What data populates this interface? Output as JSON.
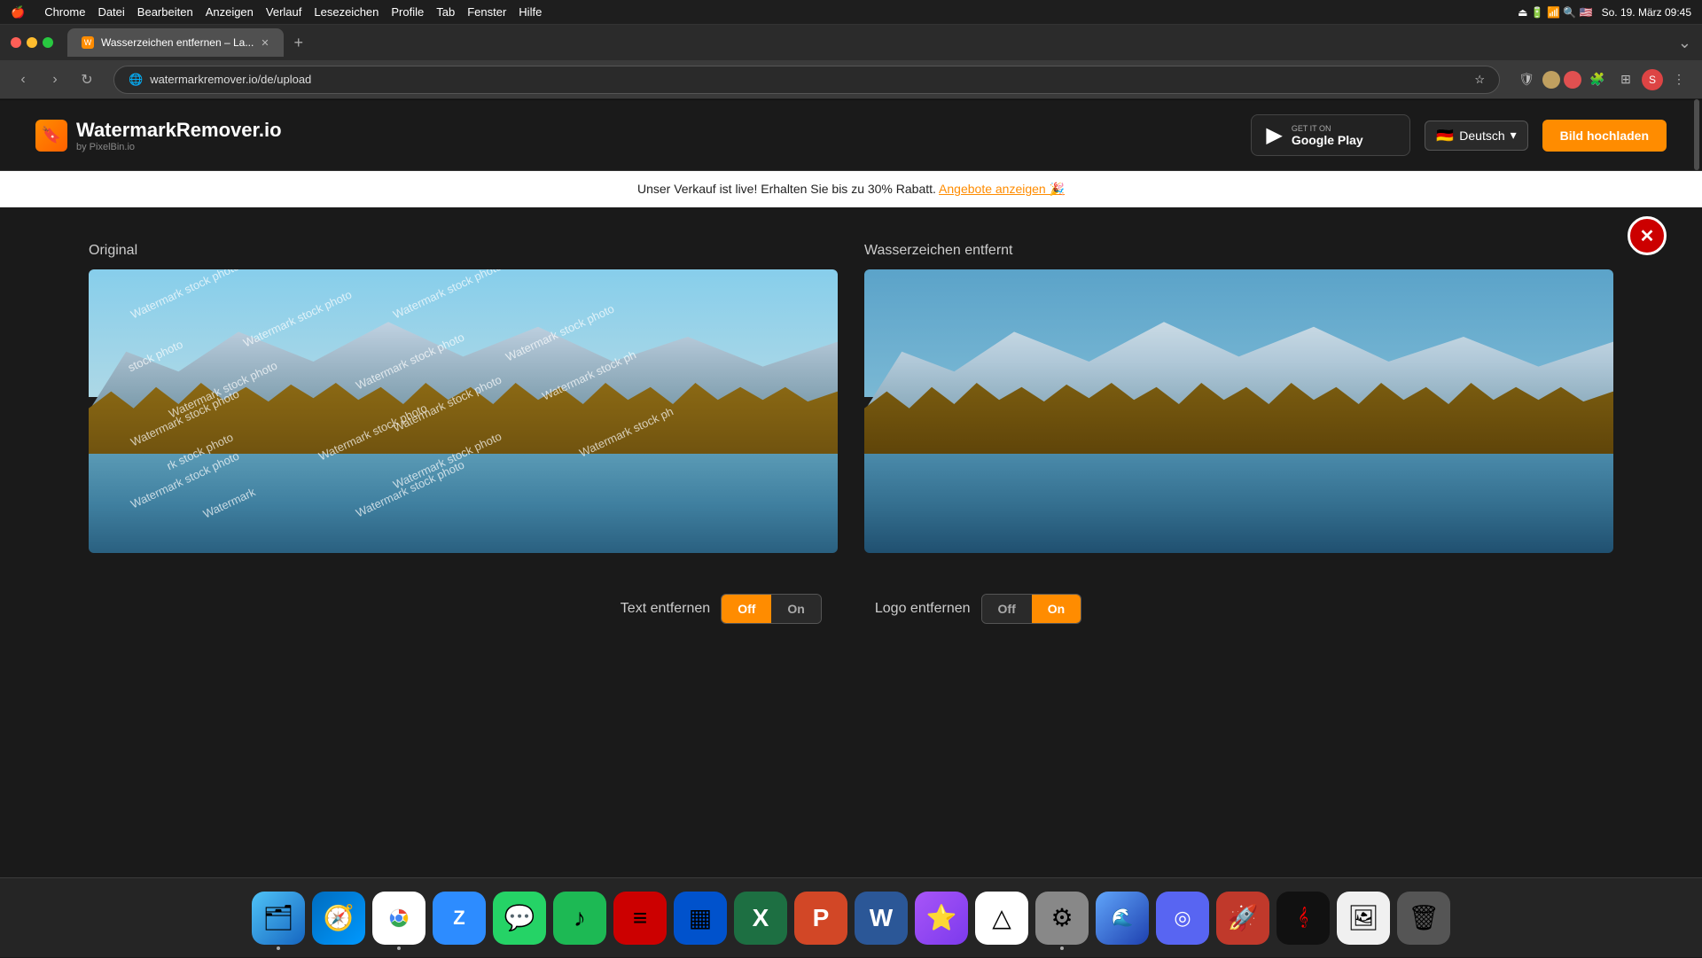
{
  "menubar": {
    "apple": "🍎",
    "items": [
      "Chrome",
      "Datei",
      "Bearbeiten",
      "Anzeigen",
      "Verlauf",
      "Lesezeichen",
      "Profile",
      "Tab",
      "Fenster",
      "Hilfe"
    ],
    "datetime": "So. 19. März  09:45"
  },
  "browser": {
    "tab_title": "Wasserzeichen entfernen – La...",
    "address": "watermarkremover.io/de/upload",
    "dropdown_label": "▾"
  },
  "header": {
    "logo_text": "WatermarkRemover.io",
    "logo_sub": "by PixelBin.io",
    "google_play_label_top": "GET IT ON",
    "google_play_label": "Google Play",
    "language": "Deutsch",
    "upload_btn": "Bild hochladen"
  },
  "banner": {
    "text": "Unser Verkauf ist live! Erhalten Sie bis zu 30% Rabatt.",
    "link_text": "Angebote anzeigen 🎉"
  },
  "main": {
    "original_label": "Original",
    "result_label": "Wasserzeichen entfernt",
    "watermark_text": "Watermark stock photo"
  },
  "controls": {
    "text_label": "Text entfernen",
    "text_off": "Off",
    "text_on": "On",
    "text_active": "off",
    "logo_label": "Logo entfernen",
    "logo_off": "Off",
    "logo_on": "On",
    "logo_active": "on"
  },
  "dock": {
    "items": [
      {
        "name": "Finder",
        "emoji": "🗂",
        "color": "#1565c0"
      },
      {
        "name": "Safari",
        "emoji": "🧭",
        "color": "#006cbe"
      },
      {
        "name": "Chrome",
        "emoji": "◉",
        "color": "#fff"
      },
      {
        "name": "Zoom",
        "emoji": "Z",
        "color": "#2d8cff"
      },
      {
        "name": "WhatsApp",
        "emoji": "📱",
        "color": "#25d366"
      },
      {
        "name": "Spotify",
        "emoji": "♪",
        "color": "#1db954"
      },
      {
        "name": "Tasks",
        "emoji": "≡",
        "color": "#cc3300"
      },
      {
        "name": "Trello",
        "emoji": "▦",
        "color": "#0052cc"
      },
      {
        "name": "Excel",
        "emoji": "✕",
        "color": "#1d6f42"
      },
      {
        "name": "PowerPoint",
        "emoji": "P",
        "color": "#d24726"
      },
      {
        "name": "Word",
        "emoji": "W",
        "color": "#2b5797"
      },
      {
        "name": "Star",
        "emoji": "★",
        "color": "#7c3aed"
      },
      {
        "name": "Drive",
        "emoji": "△",
        "color": "#34a853"
      },
      {
        "name": "Settings",
        "emoji": "⚙",
        "color": "#888"
      },
      {
        "name": "Mercury",
        "emoji": "☿",
        "color": "#1e40af"
      },
      {
        "name": "Discord",
        "emoji": "◎",
        "color": "#5865f2"
      },
      {
        "name": "RocketTypist",
        "emoji": "⌨",
        "color": "#e53e3e"
      },
      {
        "name": "Sound",
        "emoji": "𝄞",
        "color": "#222"
      },
      {
        "name": "Preview",
        "emoji": "🖼",
        "color": "#f97316"
      },
      {
        "name": "Trash",
        "emoji": "🗑",
        "color": "#555"
      }
    ]
  }
}
